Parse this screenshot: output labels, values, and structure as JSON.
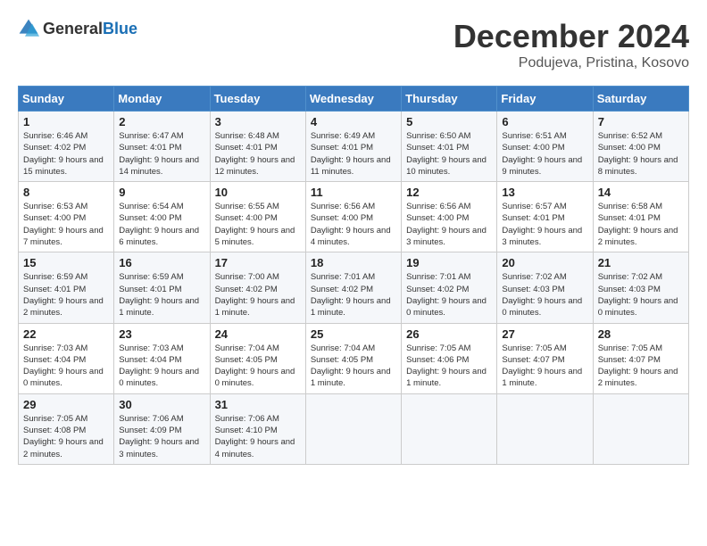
{
  "header": {
    "logo_general": "General",
    "logo_blue": "Blue",
    "month_title": "December 2024",
    "location": "Podujeva, Pristina, Kosovo"
  },
  "days_of_week": [
    "Sunday",
    "Monday",
    "Tuesday",
    "Wednesday",
    "Thursday",
    "Friday",
    "Saturday"
  ],
  "weeks": [
    [
      {
        "day": "1",
        "sunrise": "6:46 AM",
        "sunset": "4:02 PM",
        "daylight": "9 hours and 15 minutes."
      },
      {
        "day": "2",
        "sunrise": "6:47 AM",
        "sunset": "4:01 PM",
        "daylight": "9 hours and 14 minutes."
      },
      {
        "day": "3",
        "sunrise": "6:48 AM",
        "sunset": "4:01 PM",
        "daylight": "9 hours and 12 minutes."
      },
      {
        "day": "4",
        "sunrise": "6:49 AM",
        "sunset": "4:01 PM",
        "daylight": "9 hours and 11 minutes."
      },
      {
        "day": "5",
        "sunrise": "6:50 AM",
        "sunset": "4:01 PM",
        "daylight": "9 hours and 10 minutes."
      },
      {
        "day": "6",
        "sunrise": "6:51 AM",
        "sunset": "4:00 PM",
        "daylight": "9 hours and 9 minutes."
      },
      {
        "day": "7",
        "sunrise": "6:52 AM",
        "sunset": "4:00 PM",
        "daylight": "9 hours and 8 minutes."
      }
    ],
    [
      {
        "day": "8",
        "sunrise": "6:53 AM",
        "sunset": "4:00 PM",
        "daylight": "9 hours and 7 minutes."
      },
      {
        "day": "9",
        "sunrise": "6:54 AM",
        "sunset": "4:00 PM",
        "daylight": "9 hours and 6 minutes."
      },
      {
        "day": "10",
        "sunrise": "6:55 AM",
        "sunset": "4:00 PM",
        "daylight": "9 hours and 5 minutes."
      },
      {
        "day": "11",
        "sunrise": "6:56 AM",
        "sunset": "4:00 PM",
        "daylight": "9 hours and 4 minutes."
      },
      {
        "day": "12",
        "sunrise": "6:56 AM",
        "sunset": "4:00 PM",
        "daylight": "9 hours and 3 minutes."
      },
      {
        "day": "13",
        "sunrise": "6:57 AM",
        "sunset": "4:01 PM",
        "daylight": "9 hours and 3 minutes."
      },
      {
        "day": "14",
        "sunrise": "6:58 AM",
        "sunset": "4:01 PM",
        "daylight": "9 hours and 2 minutes."
      }
    ],
    [
      {
        "day": "15",
        "sunrise": "6:59 AM",
        "sunset": "4:01 PM",
        "daylight": "9 hours and 2 minutes."
      },
      {
        "day": "16",
        "sunrise": "6:59 AM",
        "sunset": "4:01 PM",
        "daylight": "9 hours and 1 minute."
      },
      {
        "day": "17",
        "sunrise": "7:00 AM",
        "sunset": "4:02 PM",
        "daylight": "9 hours and 1 minute."
      },
      {
        "day": "18",
        "sunrise": "7:01 AM",
        "sunset": "4:02 PM",
        "daylight": "9 hours and 1 minute."
      },
      {
        "day": "19",
        "sunrise": "7:01 AM",
        "sunset": "4:02 PM",
        "daylight": "9 hours and 0 minutes."
      },
      {
        "day": "20",
        "sunrise": "7:02 AM",
        "sunset": "4:03 PM",
        "daylight": "9 hours and 0 minutes."
      },
      {
        "day": "21",
        "sunrise": "7:02 AM",
        "sunset": "4:03 PM",
        "daylight": "9 hours and 0 minutes."
      }
    ],
    [
      {
        "day": "22",
        "sunrise": "7:03 AM",
        "sunset": "4:04 PM",
        "daylight": "9 hours and 0 minutes."
      },
      {
        "day": "23",
        "sunrise": "7:03 AM",
        "sunset": "4:04 PM",
        "daylight": "9 hours and 0 minutes."
      },
      {
        "day": "24",
        "sunrise": "7:04 AM",
        "sunset": "4:05 PM",
        "daylight": "9 hours and 0 minutes."
      },
      {
        "day": "25",
        "sunrise": "7:04 AM",
        "sunset": "4:05 PM",
        "daylight": "9 hours and 1 minute."
      },
      {
        "day": "26",
        "sunrise": "7:05 AM",
        "sunset": "4:06 PM",
        "daylight": "9 hours and 1 minute."
      },
      {
        "day": "27",
        "sunrise": "7:05 AM",
        "sunset": "4:07 PM",
        "daylight": "9 hours and 1 minute."
      },
      {
        "day": "28",
        "sunrise": "7:05 AM",
        "sunset": "4:07 PM",
        "daylight": "9 hours and 2 minutes."
      }
    ],
    [
      {
        "day": "29",
        "sunrise": "7:05 AM",
        "sunset": "4:08 PM",
        "daylight": "9 hours and 2 minutes."
      },
      {
        "day": "30",
        "sunrise": "7:06 AM",
        "sunset": "4:09 PM",
        "daylight": "9 hours and 3 minutes."
      },
      {
        "day": "31",
        "sunrise": "7:06 AM",
        "sunset": "4:10 PM",
        "daylight": "9 hours and 4 minutes."
      },
      null,
      null,
      null,
      null
    ]
  ]
}
